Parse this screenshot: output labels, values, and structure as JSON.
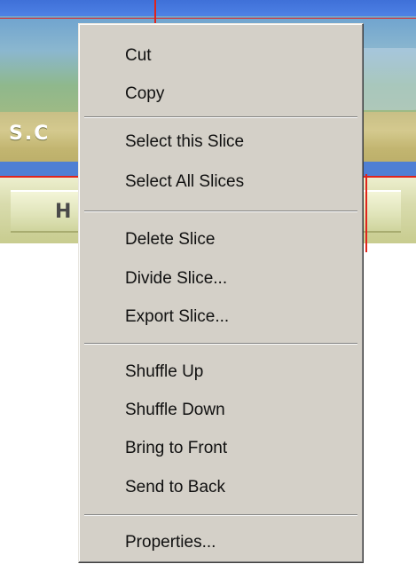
{
  "background": {
    "banner_text": "S.C",
    "nav_letter": "H"
  },
  "context_menu": {
    "groups": [
      [
        "Cut",
        "Copy"
      ],
      [
        "Select this Slice",
        "Select All Slices"
      ],
      [
        "Delete Slice",
        "Divide Slice...",
        "Export Slice..."
      ],
      [
        "Shuffle Up",
        "Shuffle Down",
        "Bring to Front",
        "Send to Back"
      ],
      [
        "Properties..."
      ]
    ],
    "items": {
      "cut": "Cut",
      "copy": "Copy",
      "select_this_slice": "Select this Slice",
      "select_all_slices": "Select All Slices",
      "delete_slice": "Delete Slice",
      "divide_slice": "Divide Slice...",
      "export_slice": "Export Slice...",
      "shuffle_up": "Shuffle Up",
      "shuffle_down": "Shuffle Down",
      "bring_to_front": "Bring to Front",
      "send_to_back": "Send to Back",
      "properties": "Properties..."
    }
  },
  "colors": {
    "menu_face": "#d4d0c8",
    "slice_line": "#e0241c",
    "top_bar_blue": "#3f70d8"
  }
}
